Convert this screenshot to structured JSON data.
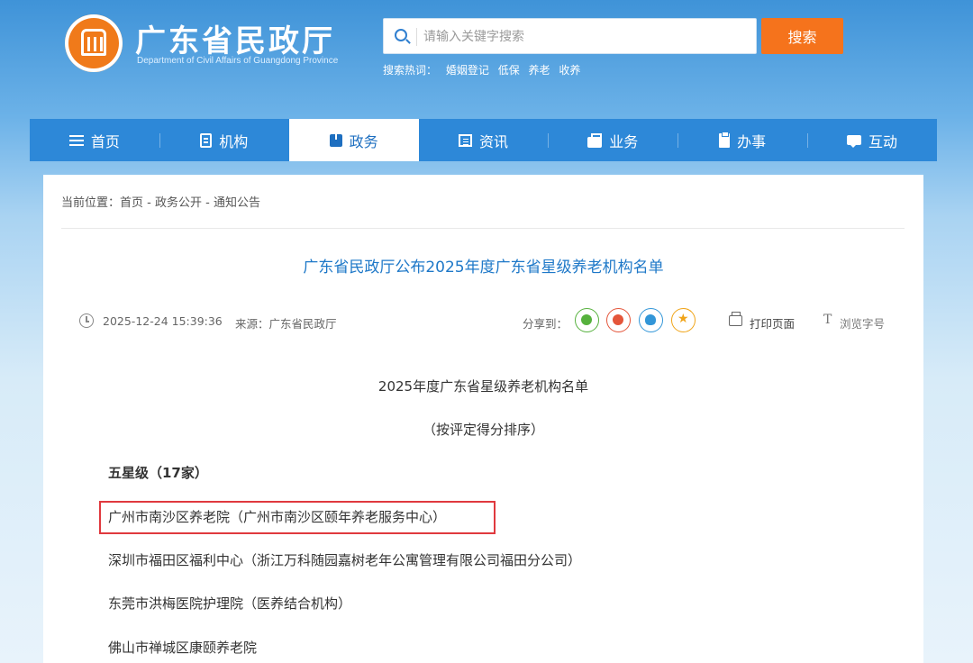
{
  "header": {
    "title": "广东省民政厅",
    "subtitle": "Department of Civil Affairs of Guangdong Province",
    "search_placeholder": "请输入关键字搜索",
    "search_button": "搜索",
    "hot_label": "搜索热词：",
    "hot_words": [
      "婚姻登记",
      "低保",
      "养老",
      "收养"
    ]
  },
  "nav": {
    "items": [
      {
        "label": "首页",
        "icon": "list-icon"
      },
      {
        "label": "机构",
        "icon": "document-icon"
      },
      {
        "label": "政务",
        "icon": "book-icon"
      },
      {
        "label": "资讯",
        "icon": "news-icon"
      },
      {
        "label": "业务",
        "icon": "briefcase-icon"
      },
      {
        "label": "办事",
        "icon": "clipboard-icon"
      },
      {
        "label": "互动",
        "icon": "chat-icon"
      }
    ],
    "active": "政务"
  },
  "breadcrumb": {
    "prefix": "当前位置：",
    "items": [
      "首页",
      "政务公开",
      "通知公告"
    ],
    "separator": " - "
  },
  "article": {
    "title": "广东省民政厅公布2025年度广东省星级养老机构名单",
    "date": "2025-12-24 15:39:36",
    "source": "来源：广东省民政厅",
    "share_label": "分享到：",
    "print_label": "打印页面",
    "font_label": "浏览字号",
    "font_icon": "T",
    "heading": "2025年度广东省星级养老机构名单",
    "subheading": "（按评定得分排序）",
    "section": "五星级（17家）",
    "items": [
      "广州市南沙区养老院（广州市南沙区颐年养老服务中心）",
      "深圳市福田区福利中心（浙江万科随园嘉树老年公寓管理有限公司福田分公司）",
      "东莞市洪梅医院护理院（医养结合机构）",
      "佛山市禅城区康颐养老院"
    ]
  },
  "colors": {
    "nav_bg": "#2d88d8",
    "title_blue": "#1e78c8",
    "search_orange": "#f5731c",
    "highlight_red": "#e0393e"
  }
}
